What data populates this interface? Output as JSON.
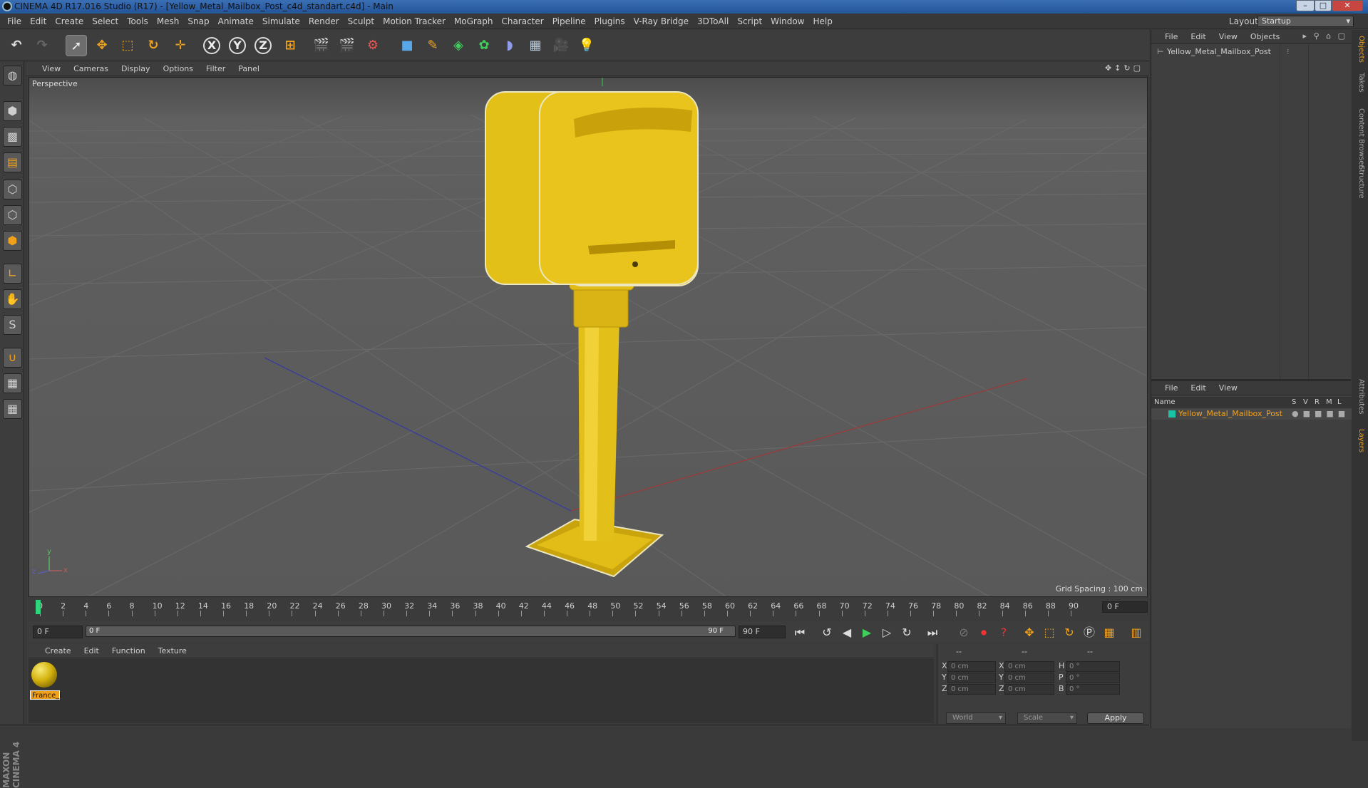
{
  "window": {
    "title": "CINEMA 4D R17.016 Studio (R17) - [Yellow_Metal_Mailbox_Post_c4d_standart.c4d] - Main",
    "controls": [
      "–",
      "□",
      "✕"
    ]
  },
  "menubar": {
    "items": [
      "File",
      "Edit",
      "Create",
      "Select",
      "Tools",
      "Mesh",
      "Snap",
      "Animate",
      "Simulate",
      "Render",
      "Sculpt",
      "Motion Tracker",
      "MoGraph",
      "Character",
      "Pipeline",
      "Plugins",
      "V-Ray Bridge",
      "3DToAll",
      "Script",
      "Window",
      "Help"
    ],
    "layout_label": "Layout:",
    "layout_value": "Startup"
  },
  "toolbar": {
    "axis_x": "X",
    "axis_y": "Y",
    "axis_z": "Z"
  },
  "viewport": {
    "menu": [
      "View",
      "Cameras",
      "Display",
      "Options",
      "Filter",
      "Panel"
    ],
    "label": "Perspective",
    "grid_spacing": "Grid Spacing : 100 cm",
    "axis_y": "y",
    "axis_x": "x",
    "axis_z": "z"
  },
  "timeline": {
    "ticks": [
      "0",
      "2",
      "4",
      "6",
      "8",
      "10",
      "12",
      "14",
      "16",
      "18",
      "20",
      "22",
      "24",
      "26",
      "28",
      "30",
      "32",
      "34",
      "36",
      "38",
      "40",
      "42",
      "44",
      "46",
      "48",
      "50",
      "52",
      "54",
      "56",
      "58",
      "60",
      "62",
      "64",
      "66",
      "68",
      "70",
      "72",
      "74",
      "76",
      "78",
      "80",
      "82",
      "84",
      "86",
      "88",
      "90"
    ],
    "current_frame": "0 F"
  },
  "transport": {
    "start_field": "0 F",
    "range_start": "0 F",
    "range_end": "90 F",
    "end_field": "90 F"
  },
  "material_manager": {
    "menu": [
      "Create",
      "Edit",
      "Function",
      "Texture"
    ],
    "material_name": "France_l"
  },
  "coordinates": {
    "header_dashes": [
      "--",
      "--",
      "--"
    ],
    "rows": [
      {
        "a": "X",
        "av": "0 cm",
        "b": "X",
        "bv": "0 cm",
        "c": "H",
        "cv": "0 °"
      },
      {
        "a": "Y",
        "av": "0 cm",
        "b": "Y",
        "bv": "0 cm",
        "c": "P",
        "cv": "0 °"
      },
      {
        "a": "Z",
        "av": "0 cm",
        "b": "Z",
        "bv": "0 cm",
        "c": "B",
        "cv": "0 °"
      }
    ],
    "world": "World",
    "scale": "Scale",
    "apply": "Apply"
  },
  "object_manager": {
    "menu": [
      "File",
      "Edit",
      "View",
      "Objects"
    ],
    "object_name": "Yellow_Metal_Mailbox_Post"
  },
  "layer_manager": {
    "menu": [
      "File",
      "Edit",
      "View"
    ],
    "columns": [
      "Name",
      "S",
      "V",
      "R",
      "M",
      "L"
    ],
    "layer_name": "Yellow_Metal_Mailbox_Post",
    "layer_color": "#19c3a3"
  },
  "right_tabs": [
    "Objects",
    "Takes",
    "Content Browser",
    "Structure",
    "Attributes",
    "Layers"
  ],
  "branding": "MAXON CINEMA 4D",
  "colors": {
    "accent_orange": "#f0a11c",
    "mailbox_yellow": "#e6c21a",
    "frame_indicator": "#2fd67b"
  }
}
